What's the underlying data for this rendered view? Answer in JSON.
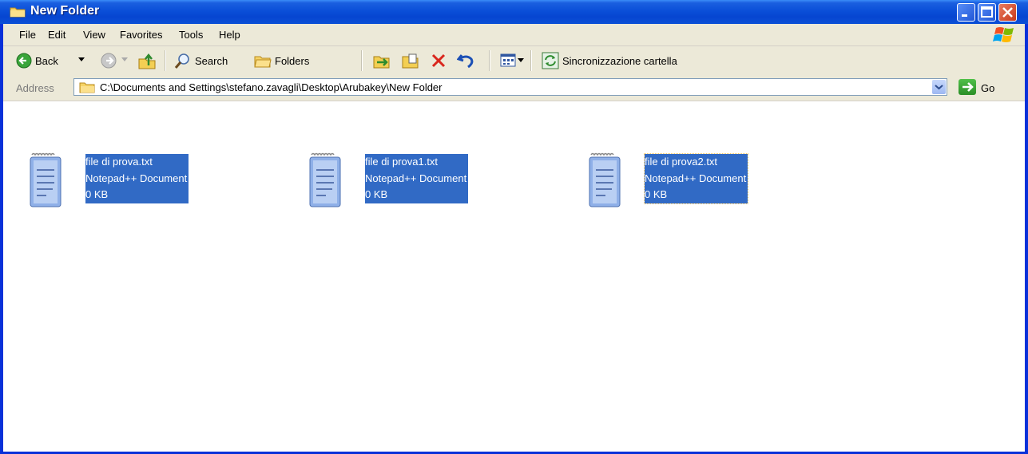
{
  "window": {
    "title": "New Folder"
  },
  "menu": [
    "File",
    "Edit",
    "View",
    "Favorites",
    "Tools",
    "Help"
  ],
  "toolbar": {
    "back_label": "Back",
    "search_label": "Search",
    "folders_label": "Folders",
    "sync_label": "Sincronizzazione cartella"
  },
  "address": {
    "label": "Address",
    "path": "C:\\Documents and Settings\\stefano.zavagli\\Desktop\\Arubakey\\New Folder",
    "go_label": "Go"
  },
  "files": [
    {
      "name": "file di prova.txt",
      "type": "Notepad++ Document",
      "size": "0 KB"
    },
    {
      "name": "file di prova1.txt",
      "type": "Notepad++ Document",
      "size": "0 KB"
    },
    {
      "name": "file di prova2.txt",
      "type": "Notepad++ Document",
      "size": "0 KB"
    }
  ],
  "colors": {
    "title_bar": "#0a4fd8",
    "selection": "#316ac5",
    "chrome": "#ece9d8"
  }
}
